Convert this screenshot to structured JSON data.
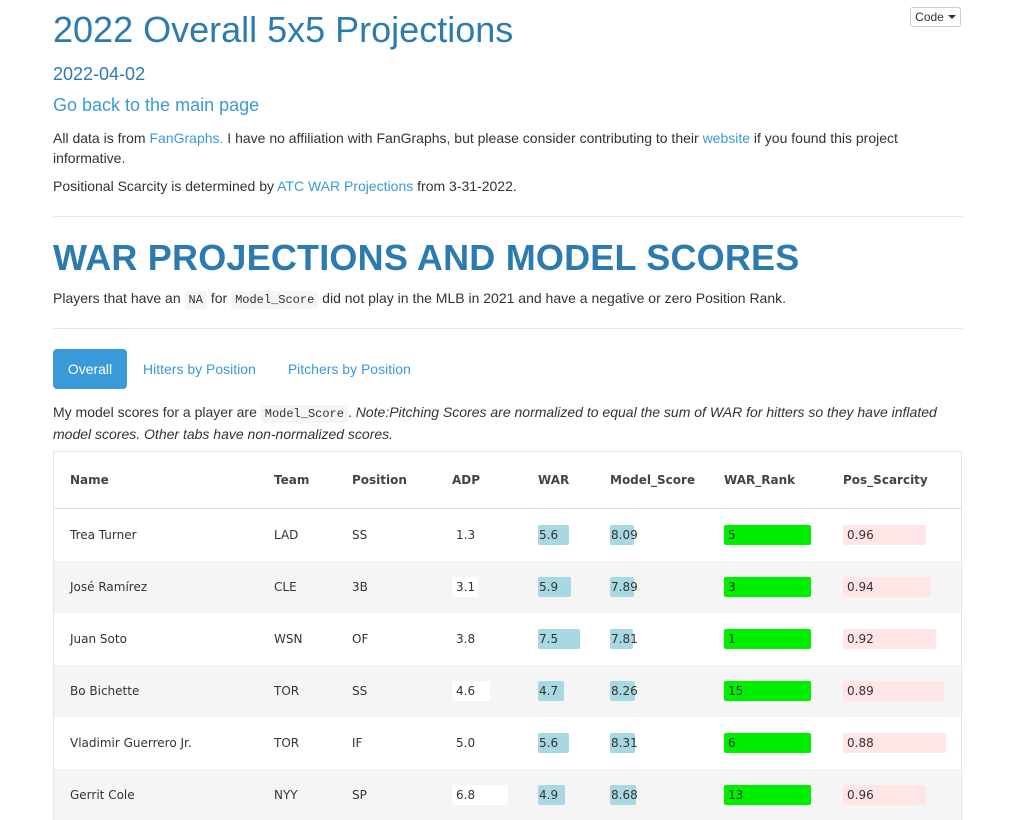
{
  "header": {
    "title": "2022 Overall 5x5 Projections",
    "date": "2022-04-02",
    "back_link": "Go back to the main page",
    "code_button": "Code"
  },
  "intro": {
    "p1_a": "All data is from ",
    "p1_link1": "FanGraphs.",
    "p1_b": " I have no affiliation with FanGraphs, but please consider contributing to their ",
    "p1_link2": "website",
    "p1_c": " if you found this project informative.",
    "p2_a": "Positional Scarcity is determined by ",
    "p2_link": "ATC WAR Projections",
    "p2_b": " from 3-31-2022."
  },
  "section": {
    "heading": "WAR PROJECTIONS AND MODEL SCORES",
    "note_a": "Players that have an ",
    "note_code1": "NA",
    "note_b": " for ",
    "note_code2": "Model_Score",
    "note_c": " did not play in the MLB in 2021 and have a negative or zero Position Rank."
  },
  "tabs": [
    "Overall",
    "Hitters by Position",
    "Pitchers by Position"
  ],
  "model_note": {
    "a": "My model scores for a player are ",
    "code": "Model_Score",
    "b": ". ",
    "italic": "Note:Pitching Scores are normalized to equal the sum of WAR for hitters so they have inflated model scores. Other tabs have non-normalized scores."
  },
  "table": {
    "columns": [
      "Name",
      "Team",
      "Position",
      "ADP",
      "WAR",
      "Model_Score",
      "WAR_Rank",
      "Pos_Scarcity"
    ],
    "rows": [
      {
        "name": "Trea Turner",
        "team": "LAD",
        "position": "SS",
        "adp": "1.3",
        "war": "5.6",
        "model_score": "8.09",
        "war_rank": "5",
        "pos_scarcity": "0.96"
      },
      {
        "name": "José Ramírez",
        "team": "CLE",
        "position": "3B",
        "adp": "3.1",
        "war": "5.9",
        "model_score": "7.89",
        "war_rank": "3",
        "pos_scarcity": "0.94"
      },
      {
        "name": "Juan Soto",
        "team": "WSN",
        "position": "OF",
        "adp": "3.8",
        "war": "7.5",
        "model_score": "7.81",
        "war_rank": "1",
        "pos_scarcity": "0.92"
      },
      {
        "name": "Bo Bichette",
        "team": "TOR",
        "position": "SS",
        "adp": "4.6",
        "war": "4.7",
        "model_score": "8.26",
        "war_rank": "15",
        "pos_scarcity": "0.89"
      },
      {
        "name": "Vladimir Guerrero Jr.",
        "team": "TOR",
        "position": "IF",
        "adp": "5.0",
        "war": "5.6",
        "model_score": "8.31",
        "war_rank": "6",
        "pos_scarcity": "0.88"
      },
      {
        "name": "Gerrit Cole",
        "team": "NYY",
        "position": "SP",
        "adp": "6.8",
        "war": "4.9",
        "model_score": "8.68",
        "war_rank": "13",
        "pos_scarcity": "0.96"
      }
    ]
  },
  "colors": {
    "title": "#2c7bb0",
    "link": "#3a9ad9",
    "war_bar": "#a8d8e2",
    "rank_bar": "#00ee00",
    "pos_bar": "#ffe5e5"
  }
}
